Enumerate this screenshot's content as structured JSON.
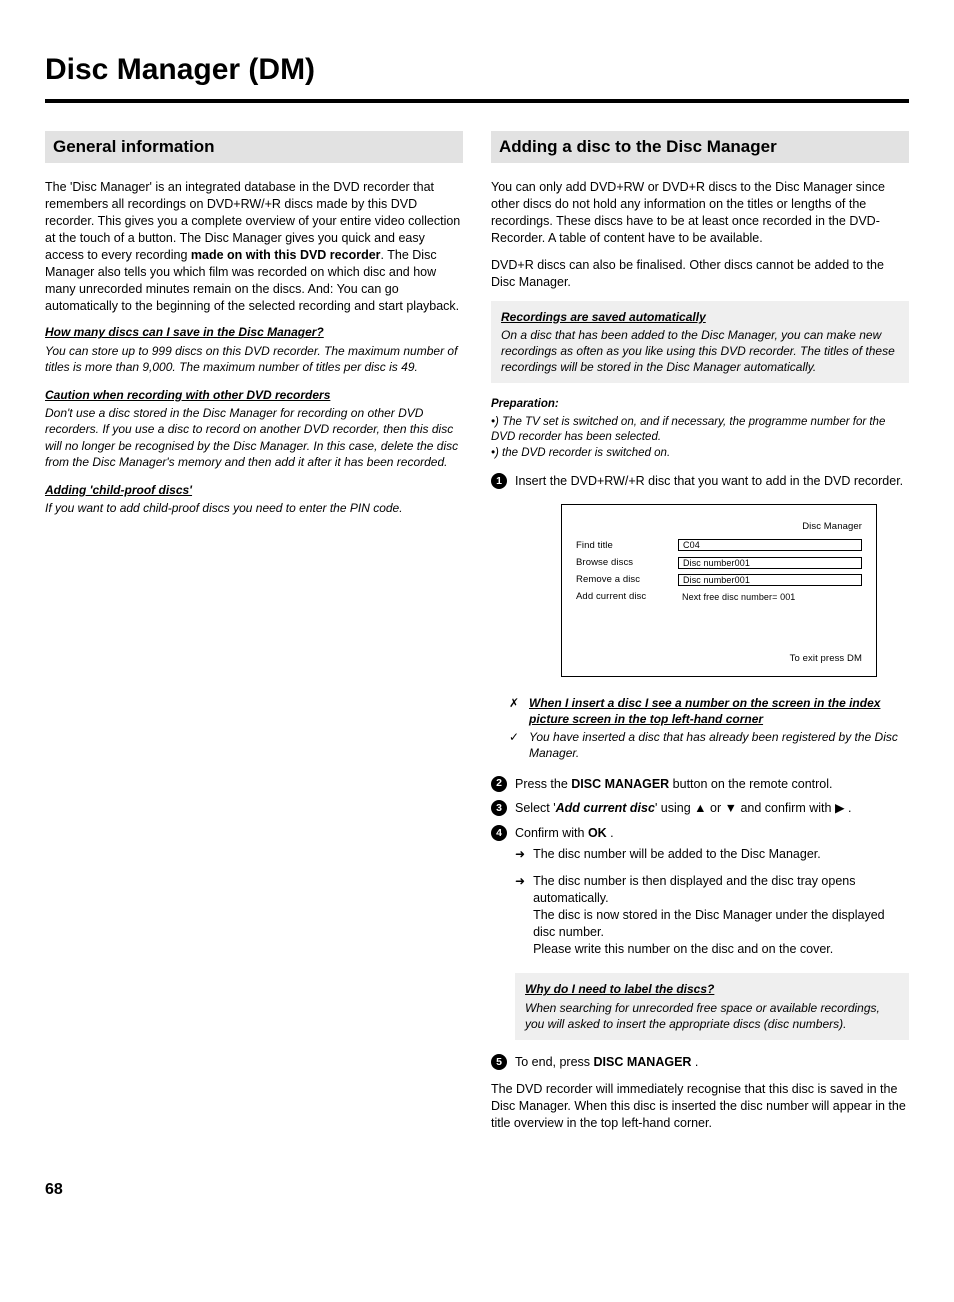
{
  "pageNumber": "68",
  "chapterTitle": "Disc Manager (DM)",
  "left": {
    "sectionTitle": "General information",
    "intro1a": "The 'Disc Manager' is an integrated database in the DVD recorder that remembers all recordings on DVD+RW/+R discs made by this DVD recorder. This gives you a complete overview of your entire video collection at the touch of a button. The Disc Manager gives you quick and easy access to every recording ",
    "intro1b": "made on with this DVD recorder",
    "intro1c": ". The Disc Manager also tells you which film was recorded on which disc and how many unrecorded minutes remain on the discs. And: You can go automatically to the beginning of the selected recording and start playback.",
    "qa1": {
      "q": "How many discs can I save in the Disc Manager?",
      "a": "You can store up to 999 discs on this DVD recorder. The maximum number of titles is more than 9,000. The maximum number of titles per disc is 49."
    },
    "qa2": {
      "q": "Caution when recording with other DVD recorders",
      "a": "Don't use a disc stored in the Disc Manager for recording on other DVD recorders. If you use a disc to record on another DVD recorder, then this disc will no longer be recognised by the Disc Manager. In this case, delete the disc from the Disc Manager's memory and then add it after it has been recorded."
    },
    "qa3": {
      "q": "Adding 'child-proof discs'",
      "a": "If you want to add child-proof discs you need to enter the PIN code."
    }
  },
  "right": {
    "sectionTitle": "Adding a disc to the Disc Manager",
    "intro1": "You can only add DVD+RW or DVD+R discs to the Disc Manager since other discs do not hold any information on the titles or lengths of the recordings. These discs have to be at least once recorded in the DVD-Recorder. A table of content have to be available.",
    "intro2": "DVD+R discs can also be finalised. Other discs cannot be added to the Disc Manager.",
    "note": {
      "q": "Recordings are saved automatically",
      "a": "On a disc that has been added to the Disc Manager, you can make new recordings as often as you like using this DVD recorder. The titles of these recordings will be stored in the Disc Manager automatically."
    },
    "prep": {
      "heading": "Preparation:",
      "line1": "•) The TV set is switched on, and if necessary, the programme number for the DVD recorder has been selected.",
      "line2": "•) the DVD recorder is switched on."
    },
    "step1": "Insert the DVD+RW/+R disc that you want to add in the DVD recorder.",
    "screen": {
      "title": "Disc Manager",
      "rows": [
        {
          "label": "Find title",
          "value": "C04",
          "boxed": true
        },
        {
          "label": "Browse discs",
          "value": "Disc number001",
          "boxed": true
        },
        {
          "label": "Remove a disc",
          "value": "Disc number001",
          "boxed": true
        },
        {
          "label": "Add current disc",
          "value": "Next free disc number= 001",
          "boxed": false
        }
      ],
      "footer": "To exit press DM"
    },
    "trouble": {
      "q": "When I insert a disc I see a number on the screen in the index picture screen in the top left-hand corner",
      "a": "You have inserted a disc that has already been registered by the Disc Manager."
    },
    "step2a": "Press the ",
    "step2b": "DISC MANAGER",
    "step2c": " button on the remote control.",
    "step3a": "Select '",
    "step3b": "Add current disc",
    "step3c": "' using ",
    "step3d": " or ",
    "step3e": " and confirm with ",
    "step3f": " .",
    "step4a": "Confirm with ",
    "step4b": "OK",
    "step4c": " .",
    "step4sub1": "The disc number will be added to the Disc Manager.",
    "step4sub2": "The disc number is then displayed and the disc tray opens automatically.",
    "step4sub3": "The disc is now stored in the Disc Manager under the displayed disc number.",
    "step4sub4": "Please write this number on the disc and on the cover.",
    "qaLabel": {
      "q": "Why do I need to label the discs?",
      "a": "When searching for unrecorded free space or available recordings, you will asked to insert the appropriate discs (disc numbers)."
    },
    "step5a": "To end, press ",
    "step5b": "DISC MANAGER",
    "step5c": " .",
    "outro": "The DVD recorder will immediately recognise that this disc is saved in the Disc Manager. When this disc is inserted the disc number will appear in the title overview in the top left-hand corner."
  }
}
